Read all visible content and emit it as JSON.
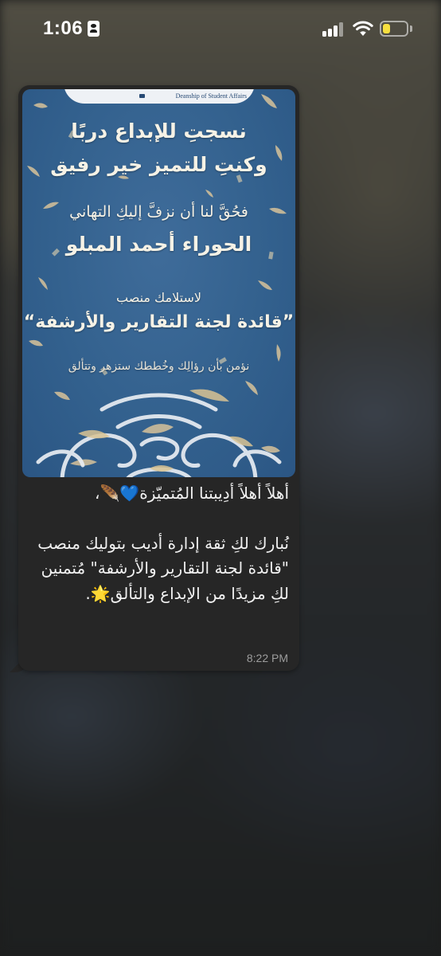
{
  "status_bar": {
    "time": "1:06",
    "battery_level": 0.2,
    "colors": {
      "battery": "#f6df3f",
      "text": "#ffffff"
    },
    "icons": [
      "contact-card-icon",
      "cellular-signal-icon",
      "wifi-icon",
      "battery-icon"
    ]
  },
  "message": {
    "image": {
      "header_text": "Deanship of Student Affairs",
      "lines": [
        "نسجتِ للإبداع دربًا",
        "وكنتِ للتميز خير رفيق",
        "فحُقَّ لنا أن نزفَّ إليكِ التهاني",
        "الحوراء أحمد المبلو",
        "لاستلامك منصب",
        "”قائدة لجنة التقارير والأرشفة“",
        "نؤمن بأن رؤالِك وخُططك ستزهر وتتألق"
      ],
      "colors": {
        "background": "#33618e",
        "confetti": "#d7c29a",
        "text": "#f6f2e6"
      }
    },
    "caption": {
      "line1": "أهلاً أهلاً أدِيبتنا المُتميّزة💙🪶،",
      "line2": "نُبارك لكِ ثقة إدارة أديب بتوليك منصب \"قائدة لجنة التقارير والأرشفة\" مُتمنين لكِ مزيدًا من الإبداع والتألق🌟."
    },
    "timestamp": "8:22 PM"
  }
}
